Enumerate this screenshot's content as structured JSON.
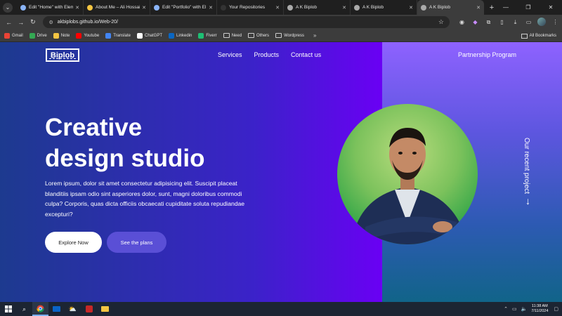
{
  "browser": {
    "tabs": [
      {
        "title": "Edit \"Home\" with Elem",
        "favicon_color": "#8ab4f8",
        "active": false
      },
      {
        "title": "About Me – Ali Hossain",
        "favicon_color": "#f4c542",
        "active": false
      },
      {
        "title": "Edit \"Portfolio\" with El",
        "favicon_color": "#8ab4f8",
        "active": false
      },
      {
        "title": "Your Repositories",
        "favicon_color": "#333333",
        "active": false
      },
      {
        "title": "A K Biplob",
        "favicon_color": "#aaaaaa",
        "active": false
      },
      {
        "title": "A K Biplob",
        "favicon_color": "#aaaaaa",
        "active": false
      },
      {
        "title": "A K Biplob",
        "favicon_color": "#aaaaaa",
        "active": true
      }
    ],
    "new_tab_label": "+",
    "window_controls": {
      "minimize": "—",
      "restore": "❐",
      "close": "✕"
    },
    "url": "akbiplobs.github.io/Web-20/",
    "bookmarks": [
      {
        "label": "Gmail",
        "icon": "gmail-icon",
        "color": "#ea4335"
      },
      {
        "label": "Drive",
        "icon": "drive-icon",
        "color": "#34a853"
      },
      {
        "label": "Note",
        "icon": "note-icon",
        "color": "#f4c542"
      },
      {
        "label": "Youtube",
        "icon": "youtube-icon",
        "color": "#ff0000"
      },
      {
        "label": "Translate",
        "icon": "translate-icon",
        "color": "#4285f4"
      },
      {
        "label": "ChatGPT",
        "icon": "chatgpt-icon",
        "color": "#ffffff"
      },
      {
        "label": "Linkedin",
        "icon": "linkedin-icon",
        "color": "#0a66c2"
      },
      {
        "label": "Fiverr",
        "icon": "fiverr-icon",
        "color": "#1dbf73"
      },
      {
        "label": "Need",
        "icon": "folder-icon",
        "color": ""
      },
      {
        "label": "Others",
        "icon": "folder-icon",
        "color": ""
      },
      {
        "label": "Wordpress",
        "icon": "folder-icon",
        "color": ""
      }
    ],
    "all_bookmarks_label": "All Bookmarks"
  },
  "site": {
    "logo": "Biplob",
    "nav": {
      "services": "Services",
      "products": "Products",
      "contact": "Contact us",
      "partnership": "Partnership Program"
    },
    "hero": {
      "title_line1": "Creative",
      "title_line2": "design studio",
      "text": "Lorem ipsum, dolor sit amet consectetur adipisicing elit. Suscipit placeat blanditiis ipsam odio sint asperiores dolor, sunt, magni doloribus commodi culpa? Corporis, quas dicta officiis obcaecati cupiditate soluta repudiandae excepturi?",
      "explore_button": "Explore Now",
      "plans_button": "See the plans"
    },
    "vertical_text": "Our recent project",
    "colors": {
      "panel_purple": "#6a00f4",
      "panel_teal": "#116489",
      "button_purple": "#5a4fd6"
    }
  },
  "taskbar": {
    "time": "11:38 AM",
    "date": "7/11/2024",
    "apps": [
      "windows-start-icon",
      "search-icon",
      "chrome-icon",
      "mail-icon",
      "weather-icon",
      "word-icon",
      "file-explorer-icon"
    ]
  }
}
